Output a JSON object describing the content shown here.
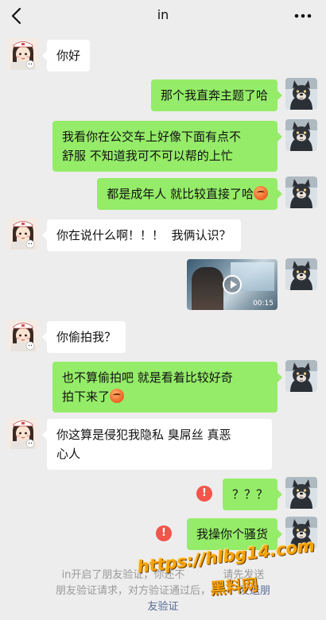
{
  "header": {
    "title": "in",
    "back_icon": "chevron-left-icon",
    "more_icon": "ellipsis-icon"
  },
  "messages": [
    {
      "from": "them",
      "text": "你好"
    },
    {
      "from": "me",
      "text": "那个我直奔主题了哈"
    },
    {
      "from": "me",
      "text_lines": [
        "我看你在公交车上好像下面有点不",
        "舒服 不知道我可不可以帮的上忙"
      ]
    },
    {
      "from": "me",
      "text": "都是成年人 就比较直接了哈",
      "emoji": "orange-face-emoji"
    },
    {
      "from": "them",
      "text": "你在说什么啊！！！  我俩认识？"
    },
    {
      "from": "me",
      "type": "video",
      "duration": "00:15"
    },
    {
      "from": "them",
      "text": "你偷拍我？"
    },
    {
      "from": "me",
      "text_lines": [
        "也不算偷拍吧 就是看着比较好奇",
        "拍下来了"
      ],
      "emoji": "orange-face-emoji"
    },
    {
      "from": "them",
      "text_lines": [
        "你这算是侵犯我隐私 臭屌丝 真恶",
        "心人"
      ]
    },
    {
      "from": "me",
      "text": "？？？",
      "failed": true
    },
    {
      "from": "me",
      "text": "我操你个骚货",
      "failed": true
    }
  ],
  "system_note": {
    "line1": "in开启了朋友验证，你还不",
    "line1_tail": "请先发送",
    "line2": "朋友验证请求，对方验证通过后，",
    "link": "发送朋",
    "line3_link": "友验证"
  },
  "watermark": {
    "url": "https://hlbg14.com",
    "name": "黑料网"
  },
  "colors": {
    "background": "#ededed",
    "outgoing_bubble": "#95ec69",
    "incoming_bubble": "#ffffff",
    "error": "#f2554b",
    "link": "#576b95"
  }
}
